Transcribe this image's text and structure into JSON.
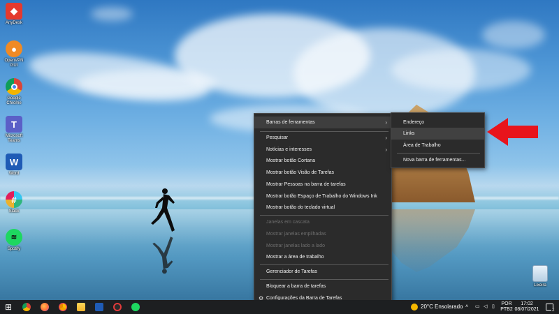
{
  "desktop": {
    "icons": [
      {
        "label": "AnyDesk",
        "icon": "anydesk-icon",
        "color": "#e5392e"
      },
      {
        "label": "OpenVPN\nGUI",
        "icon": "openvpn-icon",
        "color": "#f08a24"
      },
      {
        "label": "Google\nChrome",
        "icon": "chrome-icon",
        "color": "#ffffff"
      },
      {
        "label": "Microsoft\nTeams",
        "icon": "teams-icon",
        "color": "#5b5fc7"
      },
      {
        "label": "Word",
        "icon": "word-icon",
        "color": "#1f5bb5"
      },
      {
        "label": "Slack",
        "icon": "slack-icon",
        "color": "#ffffff"
      },
      {
        "label": "Spotify",
        "icon": "spotify-icon",
        "color": "#1ed760"
      }
    ],
    "recycle_bin": {
      "label": "Lixeira"
    }
  },
  "context_menu": {
    "items": [
      {
        "label": "Barras de ferramentas",
        "submenu": true,
        "state": "active"
      },
      {
        "label": "Pesquisar",
        "submenu": true
      },
      {
        "label": "Notícias e interesses",
        "submenu": true
      },
      {
        "label": "Mostrar botão Cortana"
      },
      {
        "label": "Mostrar botão Visão de Tarefas"
      },
      {
        "label": "Mostrar Pessoas na barra de tarefas"
      },
      {
        "label": "Mostrar botão Espaço de Trabalho do Windows Ink"
      },
      {
        "label": "Mostrar botão do teclado virtual"
      },
      {
        "label": "Janelas em cascata",
        "state": "disabled"
      },
      {
        "label": "Mostrar janelas empilhadas",
        "state": "disabled"
      },
      {
        "label": "Mostrar janelas lado a lado",
        "state": "disabled"
      },
      {
        "label": "Mostrar a área de trabalho"
      },
      {
        "label": "Gerenciador de Tarefas"
      },
      {
        "label": "Bloquear a barra de tarefas"
      },
      {
        "label": "Configurações da Barra de Tarefas"
      }
    ],
    "arrow_glyph": "›",
    "gear_glyph": "⚙"
  },
  "toolbars_submenu": {
    "items": [
      {
        "label": "Endereço"
      },
      {
        "label": "Links",
        "state": "highlighted"
      },
      {
        "label": "Área de Trabalho"
      },
      {
        "label": "Nova barra de ferramentas..."
      }
    ]
  },
  "annotation": {
    "arrow_color": "#e8141c"
  },
  "taskbar": {
    "start_glyph": "⊞",
    "pinned": [
      "chrome-icon",
      "firefox-icon",
      "chrome-canary-icon",
      "file-explorer-icon",
      "word-icon",
      "app-icon",
      "spotify-icon"
    ],
    "weather": {
      "temperature": "20°C",
      "condition": "Ensolarado"
    },
    "language": {
      "line1": "POR",
      "line2": "PTB2"
    },
    "clock": {
      "time": "17:02",
      "date": "08/07/2021"
    },
    "notification_count": "2"
  }
}
